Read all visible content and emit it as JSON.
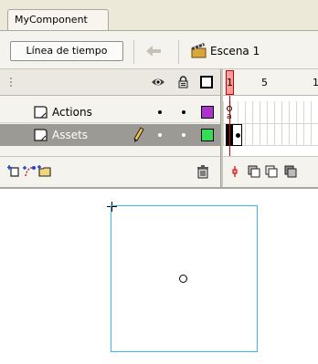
{
  "document": {
    "tab_label": "MyComponent"
  },
  "toolbar": {
    "timeline_button_label": "Línea de tiempo",
    "scene_label": "Escena 1"
  },
  "timeline": {
    "header_icons": [
      "eye-icon",
      "lock-icon",
      "outline-icon"
    ],
    "ruler_frames": [
      "1",
      "5",
      "1"
    ],
    "layers": [
      {
        "name": "Actions",
        "selected": false,
        "color": "#b030d0",
        "visible": true,
        "locked": false
      },
      {
        "name": "Assets",
        "selected": true,
        "color": "#33dd55",
        "visible": true,
        "locked": false
      }
    ],
    "footer_icons": [
      "insert-layer-icon",
      "add-motion-guide-icon",
      "insert-folder-icon",
      "delete-layer-icon"
    ],
    "frame_footer_icons": [
      "center-frame-icon",
      "onion-skin-icon",
      "onion-outlines-icon",
      "edit-multiple-frames-icon"
    ]
  },
  "colors": {
    "selected_row": "#9b9a95",
    "playhead": "#cc0000",
    "symbol_outline": "#38b8e8"
  }
}
